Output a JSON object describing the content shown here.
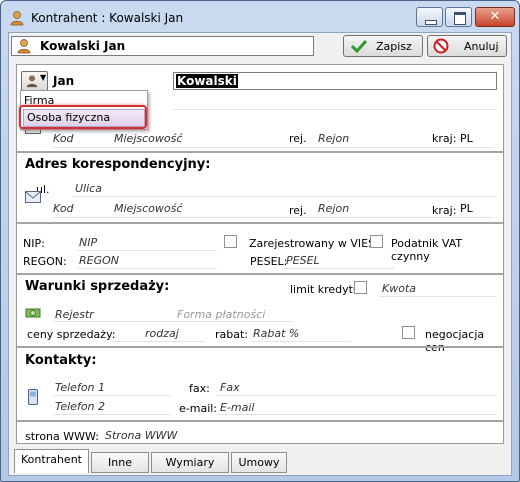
{
  "window": {
    "title": "Kontrahent : Kowalski Jan"
  },
  "toolbar": {
    "name": "Kowalski Jan",
    "save_label": "Zapisz",
    "cancel_label": "Anuluj"
  },
  "person": {
    "first_name": "Jan",
    "last_name": "Kowalski"
  },
  "type_menu": {
    "items": [
      "Firma",
      "Osoba fizyczna"
    ],
    "highlighted": "Osoba fizyczna"
  },
  "main_address": {
    "kod": "Kod",
    "miejscowosc": "Miejscowość",
    "rej_label": "rej.",
    "rejon": "Rejon",
    "kraj_label": "kraj:",
    "kraj": "PL"
  },
  "corr_address": {
    "heading": "Adres korespondencyjny:",
    "ul_label": "ul.",
    "ulica": "Ulica",
    "kod": "Kod",
    "miejscowosc": "Miejscowość",
    "rej_label": "rej.",
    "rejon": "Rejon",
    "kraj_label": "kraj:",
    "kraj": "PL"
  },
  "tax": {
    "nip_label": "NIP:",
    "nip": "NIP",
    "vies_label": "Zarejestrowany w VIES",
    "vat_label": "Podatnik VAT czynny",
    "regon_label": "REGON:",
    "regon": "REGON",
    "pesel_label": "PESEL:",
    "pesel": "PESEL"
  },
  "sales": {
    "heading": "Warunki sprzedaży:",
    "credit_label": "limit kredytu:",
    "credit": "Kwota",
    "rejestr": "Rejestr",
    "forma": "Forma płatności",
    "prices_label": "ceny sprzedaży:",
    "rodzaj": "rodzaj",
    "rabat_label": "rabat:",
    "rabat": "Rabat %",
    "negotiation_label": "negocjacja cen"
  },
  "contacts": {
    "heading": "Kontakty:",
    "phone1": "Telefon 1",
    "phone2": "Telefon 2",
    "fax_label": "fax:",
    "fax": "Fax",
    "email_label": "e-mail:",
    "email": "E-mail"
  },
  "website": {
    "label": "strona WWW:",
    "value": "Strona WWW"
  },
  "tabs": [
    "Kontrahent",
    "Inne",
    "Wymiary",
    "Umowy"
  ],
  "colors": {
    "selection": "#000000",
    "highlight_frame": "#d3313a",
    "window_frame": "#b4c9e6"
  }
}
